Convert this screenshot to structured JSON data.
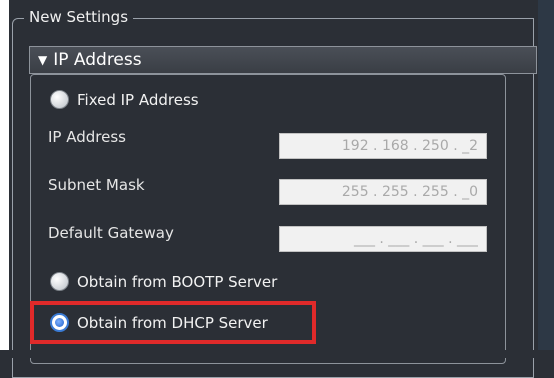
{
  "group": {
    "title": "New Settings"
  },
  "section": {
    "title": "IP Address",
    "toggle_glyph": "▼"
  },
  "options": {
    "fixed": {
      "label": "Fixed IP Address",
      "selected": false
    },
    "bootp": {
      "label": "Obtain from BOOTP Server",
      "selected": false
    },
    "dhcp": {
      "label": "Obtain from DHCP Server",
      "selected": true
    }
  },
  "fields": {
    "ip": {
      "label": "IP Address",
      "value": "192 . 168 . 250 . _2"
    },
    "mask": {
      "label": "Subnet Mask",
      "value": "255 . 255 . 255 . _0"
    },
    "gateway": {
      "label": "Default Gateway",
      "value": "___ . ___ . ___ . ___"
    }
  },
  "colors": {
    "highlight": "#e02a2a",
    "background": "#2b2f36",
    "accent": "#3a7bd5"
  }
}
